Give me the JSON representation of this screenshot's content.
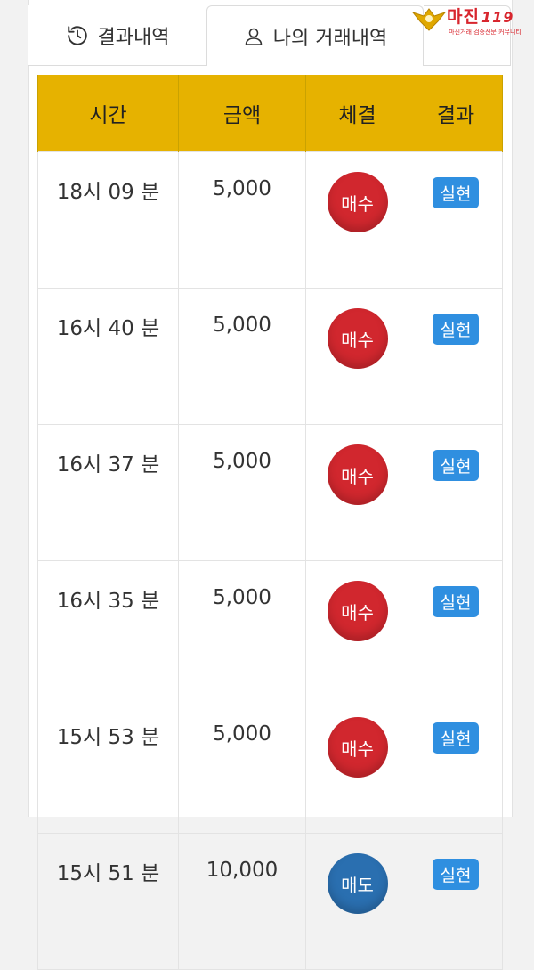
{
  "tabs": {
    "results_label": "결과내역",
    "my_trades_label": "나의 거래내역"
  },
  "logo": {
    "title": "마진",
    "suffix": "119",
    "tagline": "마진거래 검증전문 커뮤니티"
  },
  "table": {
    "headers": [
      "시간",
      "금액",
      "체결",
      "결과"
    ],
    "rows": [
      {
        "time": "18시 09 분",
        "amount": "5,000",
        "execution": "매수",
        "result": "실현"
      },
      {
        "time": "16시 40 분",
        "amount": "5,000",
        "execution": "매수",
        "result": "실현"
      },
      {
        "time": "16시 37 분",
        "amount": "5,000",
        "execution": "매수",
        "result": "실현"
      },
      {
        "time": "16시 35 분",
        "amount": "5,000",
        "execution": "매수",
        "result": "실현"
      },
      {
        "time": "15시 53 분",
        "amount": "5,000",
        "execution": "매수",
        "result": "실현"
      },
      {
        "time": "15시 51 분",
        "amount": "10,000",
        "execution": "매도",
        "result": "실현"
      }
    ]
  },
  "colors": {
    "header_bg": "#e6b200",
    "buy": "#d1272e",
    "sell": "#2a6fb0",
    "result_badge": "#2f8fe0"
  },
  "icons": {
    "results_tab": "history-icon",
    "my_trades_tab": "user-icon"
  }
}
